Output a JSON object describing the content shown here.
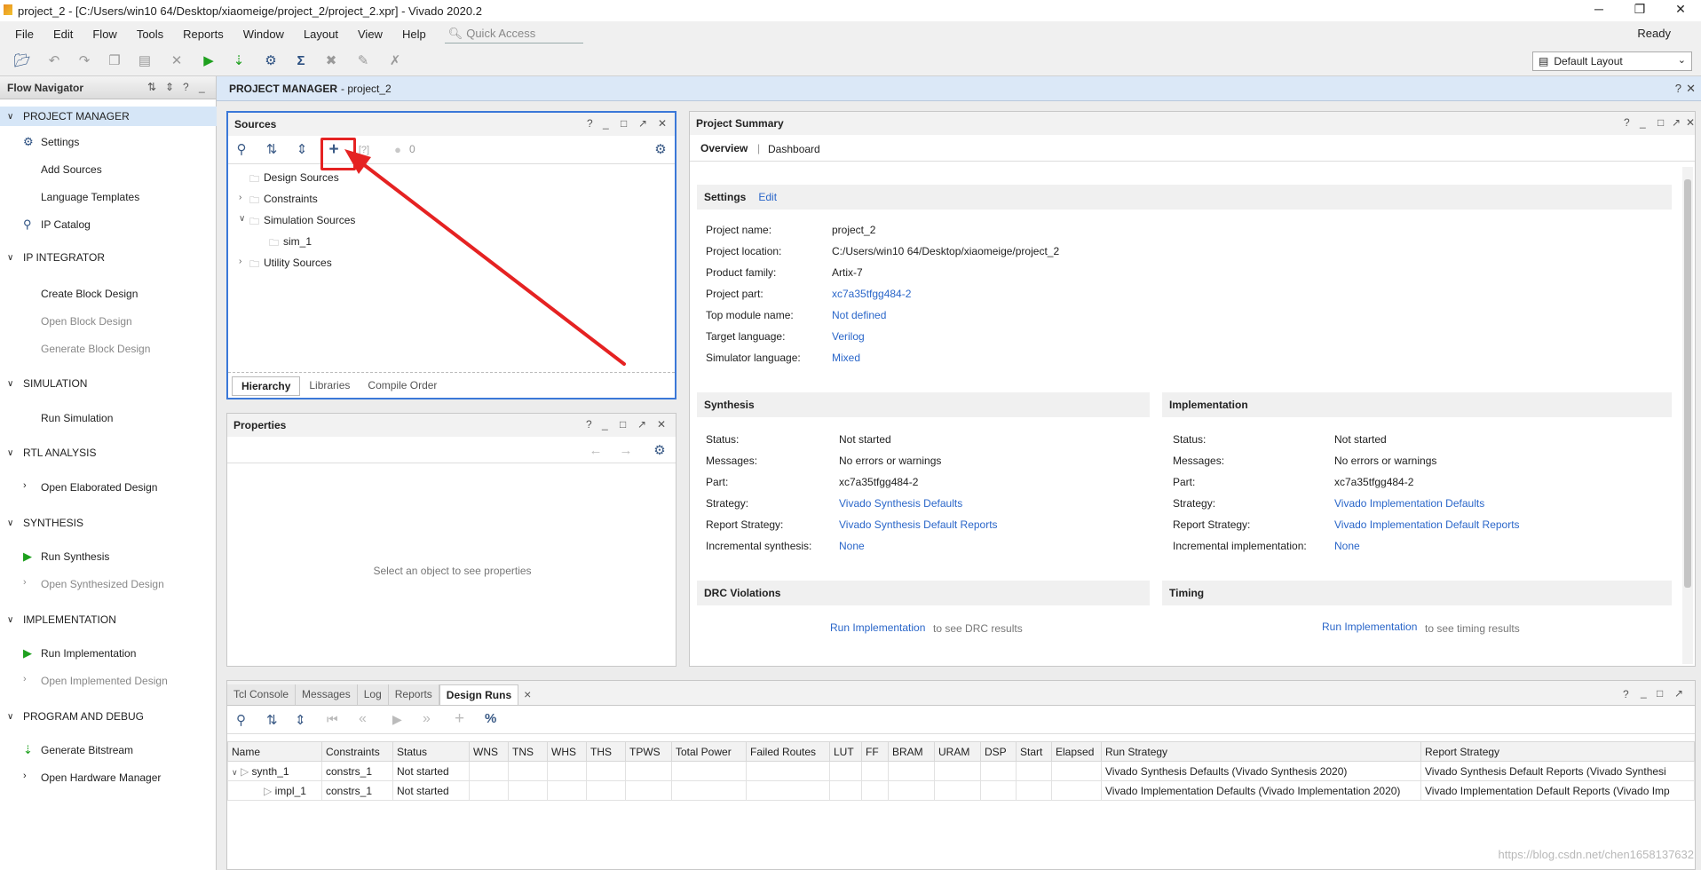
{
  "window": {
    "title": "project_2 - [C:/Users/win10 64/Desktop/xiaomeige/project_2/project_2.xpr] - Vivado 2020.2",
    "minimize": "─",
    "restore": "❐",
    "close": "✕"
  },
  "menu": {
    "items": [
      "File",
      "Edit",
      "Flow",
      "Tools",
      "Reports",
      "Window",
      "Layout",
      "View",
      "Help"
    ],
    "quick_access_placeholder": "Quick Access",
    "status": "Ready"
  },
  "toolbar": {
    "layout_select": "Default Layout"
  },
  "flow_navigator": {
    "title": "Flow Navigator",
    "sections": [
      {
        "label": "PROJECT MANAGER",
        "items": [
          "Settings",
          "Add Sources",
          "Language Templates",
          "IP Catalog"
        ]
      },
      {
        "label": "IP INTEGRATOR",
        "items": [
          "Create Block Design",
          "Open Block Design",
          "Generate Block Design"
        ]
      },
      {
        "label": "SIMULATION",
        "items": [
          "Run Simulation"
        ]
      },
      {
        "label": "RTL ANALYSIS",
        "items": [
          "Open Elaborated Design"
        ]
      },
      {
        "label": "SYNTHESIS",
        "items": [
          "Run Synthesis",
          "Open Synthesized Design"
        ]
      },
      {
        "label": "IMPLEMENTATION",
        "items": [
          "Run Implementation",
          "Open Implemented Design"
        ]
      },
      {
        "label": "PROGRAM AND DEBUG",
        "items": [
          "Generate Bitstream",
          "Open Hardware Manager"
        ]
      }
    ]
  },
  "project_manager": {
    "title": "PROJECT MANAGER",
    "project": "- project_2"
  },
  "sources": {
    "title": "Sources",
    "count": "0",
    "tree": [
      "Design Sources",
      "Constraints",
      "Simulation Sources",
      "sim_1",
      "Utility Sources"
    ],
    "tabs": [
      "Hierarchy",
      "Libraries",
      "Compile Order"
    ]
  },
  "properties": {
    "title": "Properties",
    "empty": "Select an object to see properties"
  },
  "summary": {
    "title": "Project Summary",
    "tabs": [
      "Overview",
      "Dashboard"
    ],
    "settings": {
      "title": "Settings",
      "edit": "Edit",
      "rows": [
        {
          "k": "Project name:",
          "v": "project_2"
        },
        {
          "k": "Project location:",
          "v": "C:/Users/win10 64/Desktop/xiaomeige/project_2"
        },
        {
          "k": "Product family:",
          "v": "Artix-7"
        },
        {
          "k": "Project part:",
          "v": "xc7a35tfgg484-2"
        },
        {
          "k": "Top module name:",
          "v": "Not defined"
        },
        {
          "k": "Target language:",
          "v": "Verilog"
        },
        {
          "k": "Simulator language:",
          "v": "Mixed"
        }
      ]
    },
    "synthesis": {
      "title": "Synthesis",
      "rows": [
        {
          "k": "Status:",
          "v": "Not started"
        },
        {
          "k": "Messages:",
          "v": "No errors or warnings"
        },
        {
          "k": "Part:",
          "v": "xc7a35tfgg484-2"
        },
        {
          "k": "Strategy:",
          "v": "Vivado Synthesis Defaults"
        },
        {
          "k": "Report Strategy:",
          "v": "Vivado Synthesis Default Reports"
        },
        {
          "k": "Incremental synthesis:",
          "v": "None"
        }
      ]
    },
    "implementation": {
      "title": "Implementation",
      "rows": [
        {
          "k": "Status:",
          "v": "Not started"
        },
        {
          "k": "Messages:",
          "v": "No errors or warnings"
        },
        {
          "k": "Part:",
          "v": "xc7a35tfgg484-2"
        },
        {
          "k": "Strategy:",
          "v": "Vivado Implementation Defaults"
        },
        {
          "k": "Report Strategy:",
          "v": "Vivado Implementation Default Reports"
        },
        {
          "k": "Incremental implementation:",
          "v": "None"
        }
      ]
    },
    "drc": {
      "title": "DRC Violations",
      "link": "Run Implementation",
      "text": "to see DRC results"
    },
    "timing": {
      "title": "Timing",
      "link": "Run Implementation",
      "text": "to see timing results"
    }
  },
  "bottom": {
    "tabs": [
      "Tcl Console",
      "Messages",
      "Log",
      "Reports",
      "Design Runs"
    ],
    "close": "×",
    "columns": [
      "Name",
      "Constraints",
      "Status",
      "WNS",
      "TNS",
      "WHS",
      "THS",
      "TPWS",
      "Total Power",
      "Failed Routes",
      "LUT",
      "FF",
      "BRAM",
      "URAM",
      "DSP",
      "Start",
      "Elapsed",
      "Run Strategy",
      "Report Strategy"
    ],
    "rows": [
      {
        "name": "synth_1",
        "constraints": "constrs_1",
        "status": "Not started",
        "run_strategy": "Vivado Synthesis Defaults (Vivado Synthesis 2020)",
        "report_strategy": "Vivado Synthesis Default Reports (Vivado Synthesi"
      },
      {
        "name": "impl_1",
        "constraints": "constrs_1",
        "status": "Not started",
        "run_strategy": "Vivado Implementation Defaults (Vivado Implementation 2020)",
        "report_strategy": "Vivado Implementation Default Reports (Vivado Imp"
      }
    ]
  },
  "watermark": "https://blog.csdn.net/chen1658137632",
  "colors": {
    "accent": "#2a66c9",
    "annotation": "#e52222",
    "header_band": "#dbe8f7",
    "run_green": "#1ea01e"
  }
}
